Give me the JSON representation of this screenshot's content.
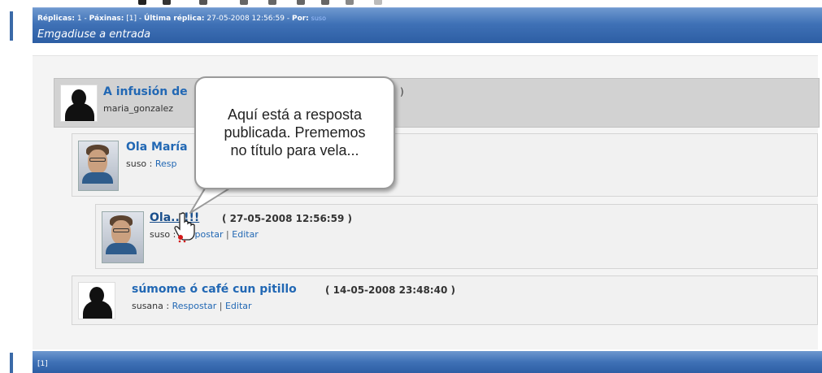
{
  "header": {
    "line1_replies_label": "Réplicas:",
    "line1_replies_value": "1",
    "line1_pages_label": "Páxinas:",
    "line1_pages_value": "[1]",
    "line1_last_label": "Última réplica:",
    "line1_last_value": "27-05-2008 12:56:59",
    "line1_by_label": "Por:",
    "line1_by_user": "suso",
    "line2": "Emgadiuse a entrada"
  },
  "entries": [
    {
      "title": "A infusión de",
      "date_tail": ")",
      "author": "maria_gonzalez",
      "avatar": "silhouette-avatar"
    },
    {
      "title": "Ola María",
      "author": "suso",
      "author_sep": " : ",
      "link": "Resp",
      "avatar": "photo-avatar"
    },
    {
      "title": "Ola...!!!",
      "date": "( 27-05-2008 12:56:59 )",
      "author": "suso",
      "author_sep": " : ",
      "reply_link": "Respostar",
      "divider": "|",
      "edit_link": "Editar",
      "avatar": "photo-avatar"
    },
    {
      "title": "súmome ó café cun pitillo",
      "date": "( 14-05-2008 23:48:40 )",
      "author": "susana",
      "author_sep": " : ",
      "reply_link": "Respostar",
      "divider": "|",
      "edit_link": "Editar",
      "avatar": "silhouette-avatar"
    }
  ],
  "callout": {
    "text": "Aquí está a resposta\npublicada. Prememos\nno título para vela..."
  },
  "footer": {
    "pages": "[1]"
  },
  "colors": {
    "header_blue": "#3f71b6",
    "link_blue": "#2268b4",
    "highlight_gray": "#d2d2d2"
  }
}
